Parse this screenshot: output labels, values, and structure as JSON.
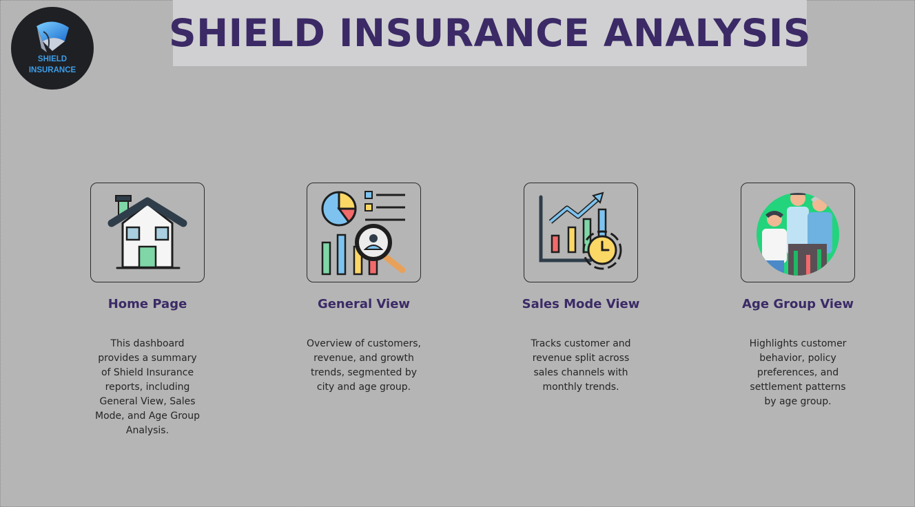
{
  "header": {
    "title": "SHIELD INSURANCE ANALYSIS",
    "logo": {
      "line1": "SHIELD",
      "line2": "INSURANCE",
      "icon": "shield-logo-icon",
      "colors": {
        "bg": "#1f2024",
        "accent": "#3d9ee8"
      }
    }
  },
  "colors": {
    "background": "#b5b5b5",
    "title_box": "#d0d0d2",
    "title_text": "#3b2a66",
    "body_text": "#252525"
  },
  "cards": [
    {
      "icon": "house-icon",
      "title": "Home Page",
      "description": "This dashboard provides a summary of Shield Insurance reports, including General View, Sales Mode, and Age Group Analysis."
    },
    {
      "icon": "analytics-report-icon",
      "title": "General View",
      "description": "Overview of customers, revenue, and growth trends, segmented by city and age group."
    },
    {
      "icon": "sales-trend-clock-icon",
      "title": "Sales Mode View",
      "description": "Tracks customer and revenue split across sales channels with monthly trends."
    },
    {
      "icon": "age-group-people-icon",
      "title": "Age Group View",
      "description": "Highlights customer behavior, policy preferences, and settlement patterns by age group."
    }
  ]
}
